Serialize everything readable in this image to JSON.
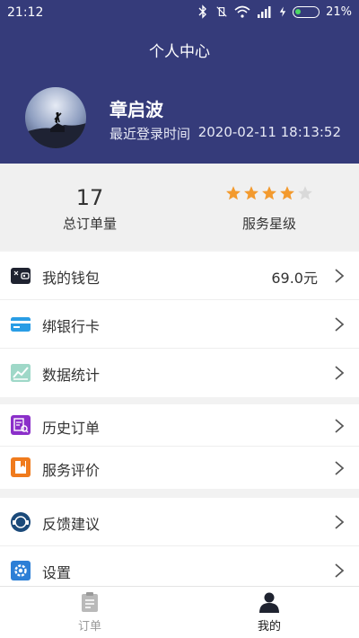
{
  "status_bar": {
    "time": "21:12",
    "battery": "21%"
  },
  "header": {
    "title": "个人中心",
    "user_name": "章启波",
    "last_login_label": "最近登录时间",
    "last_login_time": "2020-02-11 18:13:52"
  },
  "stats": {
    "orders_value": "17",
    "orders_label": "总订单量",
    "rating_stars": 4,
    "rating_max": 5,
    "rating_label": "服务星级"
  },
  "menu": {
    "wallet": {
      "label": "我的钱包",
      "value": "69.0元"
    },
    "bank_card": {
      "label": "绑银行卡"
    },
    "statistics": {
      "label": "数据统计"
    },
    "history": {
      "label": "历史订单"
    },
    "review": {
      "label": "服务评价"
    },
    "feedback": {
      "label": "反馈建议"
    },
    "settings": {
      "label": "设置"
    }
  },
  "tabbar": {
    "orders": "订单",
    "mine": "我的"
  },
  "colors": {
    "header": "#353b7a",
    "star": "#f39a2e",
    "star_empty": "#d9d9d9",
    "tab_active": "#1a1a1a",
    "tab_inactive": "#9a9a9a"
  }
}
